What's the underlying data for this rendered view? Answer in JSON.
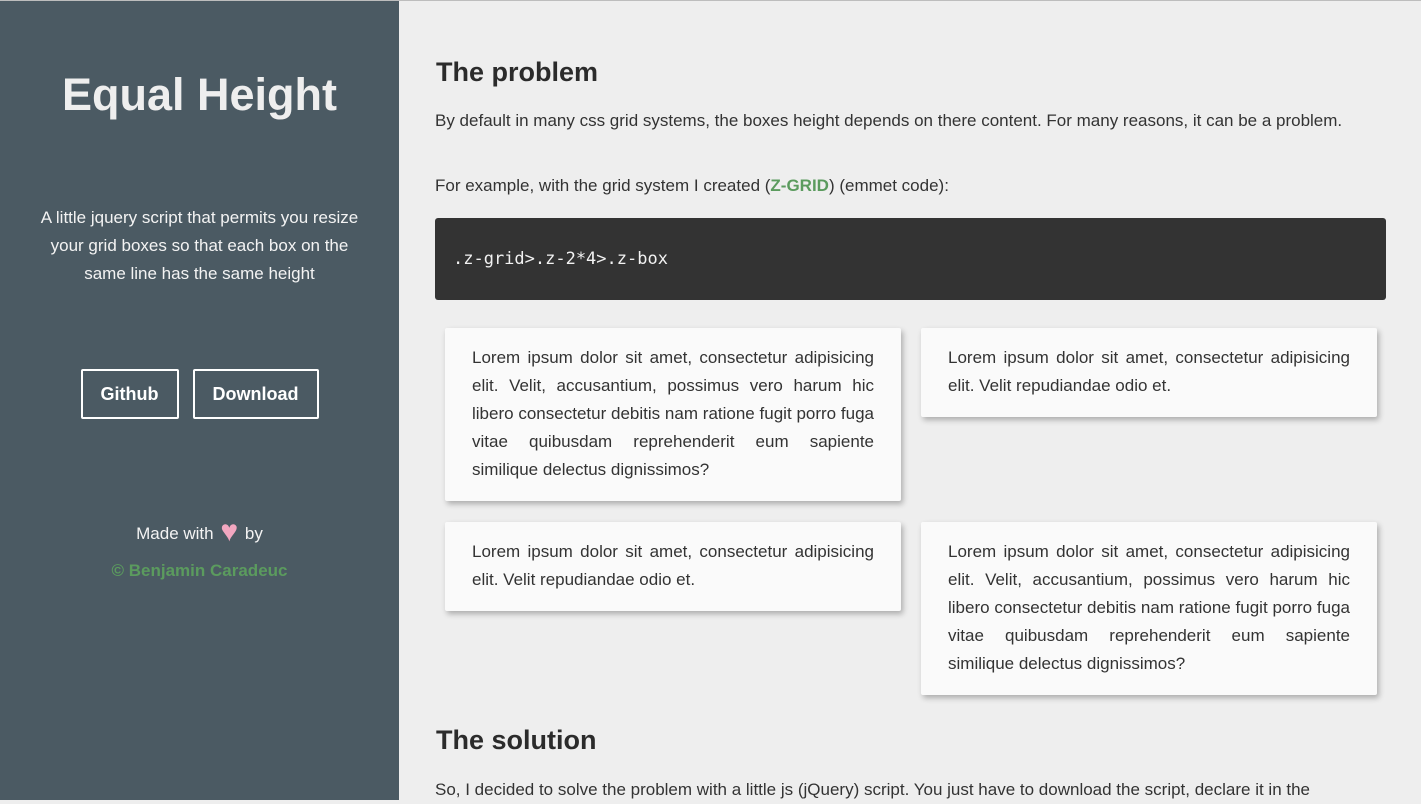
{
  "sidebar": {
    "title": "Equal Height",
    "tagline": "A little jquery script that permits you resize your grid boxes so that each box on the same line has the same height",
    "buttons": {
      "github_label": "Github",
      "download_label": "Download"
    },
    "footer": {
      "made_with": "Made with",
      "heart": "♥",
      "by": "by",
      "author": "© Benjamin Caradeuc"
    }
  },
  "main": {
    "problem": {
      "heading": "The problem",
      "paragraph1": "By default in many css grid systems, the boxes height depends on there content. For many reasons, it can be a problem.",
      "paragraph2_before": "For example, with the grid system I created (",
      "paragraph2_link": "Z-GRID",
      "paragraph2_after": ") (emmet code):",
      "code": ".z-grid>.z-2*4>.z-box",
      "boxes": [
        "Lorem ipsum dolor sit amet, consectetur adipisicing elit. Velit, accusantium, possimus vero harum hic libero consectetur debitis nam ratione fugit porro fuga vitae quibusdam reprehenderit eum sapiente similique delectus dignissimos?",
        "Lorem ipsum dolor sit amet, consectetur adipisicing elit. Velit repudiandae odio et.",
        "Lorem ipsum dolor sit amet, consectetur adipisicing elit. Velit repudiandae odio et.",
        "Lorem ipsum dolor sit amet, consectetur adipisicing elit. Velit, accusantium, possimus vero harum hic libero consectetur debitis nam ratione fugit porro fuga vitae quibusdam reprehenderit eum sapiente similique delectus dignissimos?"
      ]
    },
    "solution": {
      "heading": "The solution",
      "paragraph1": "So, I decided to solve the problem with a little js (jQuery) script. You just have to download the script, declare it in the"
    }
  },
  "colors": {
    "sidebar_bg": "#4b5a63",
    "page_bg": "#eeeeee",
    "accent_green": "#5b9b5e",
    "code_bg": "#333333",
    "heart_pink": "#f2a7c0"
  }
}
